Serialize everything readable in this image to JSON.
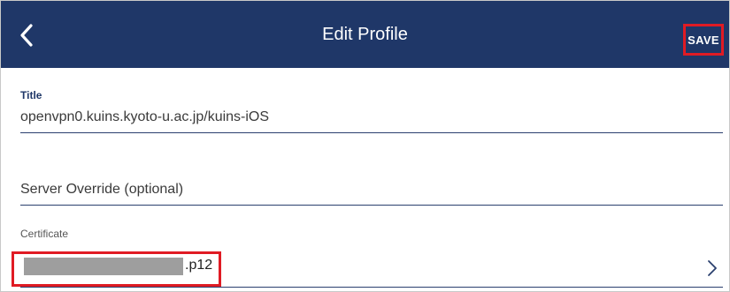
{
  "header": {
    "title": "Edit Profile",
    "save_label": "SAVE",
    "background": "#1f3768",
    "highlight_color": "#e01b24"
  },
  "fields": {
    "title": {
      "label": "Title",
      "value": "openvpn0.kuins.kyoto-u.ac.jp/kuins-iOS"
    },
    "server_override": {
      "placeholder": "Server Override (optional)",
      "value": ""
    },
    "certificate": {
      "label": "Certificate",
      "value_suffix": ".p12"
    }
  },
  "icons": {
    "back": "chevron-left-icon",
    "certificate_arrow": "chevron-right-icon"
  }
}
